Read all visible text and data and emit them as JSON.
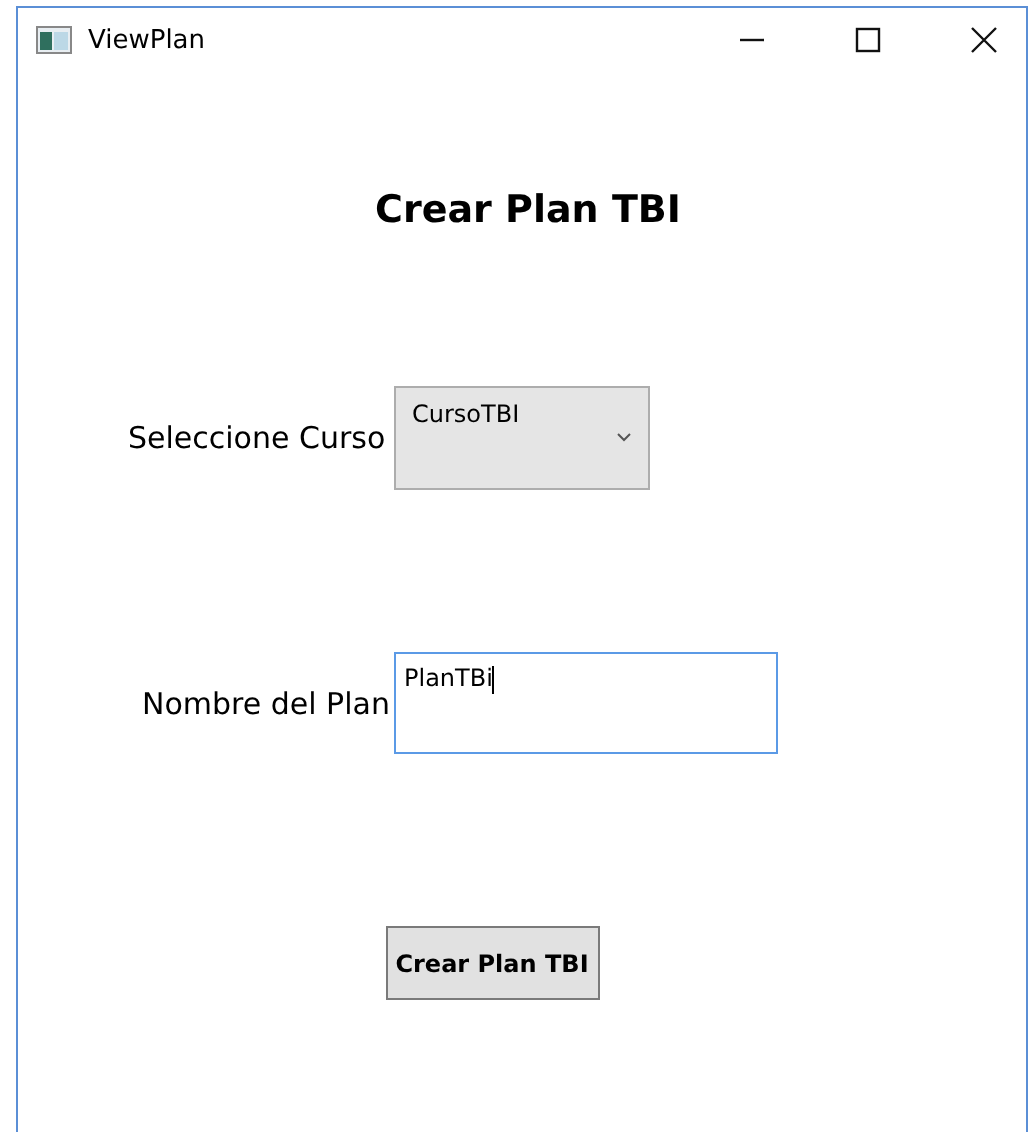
{
  "window": {
    "title": "ViewPlan"
  },
  "heading": "Crear Plan TBI",
  "course": {
    "label": "Seleccione Curso",
    "value": "CursoTBI"
  },
  "plan_name": {
    "label": "Nombre del Plan",
    "value": "PlanTBi",
    "focused": true
  },
  "buttons": [
    "Crear Plan TBI"
  ]
}
